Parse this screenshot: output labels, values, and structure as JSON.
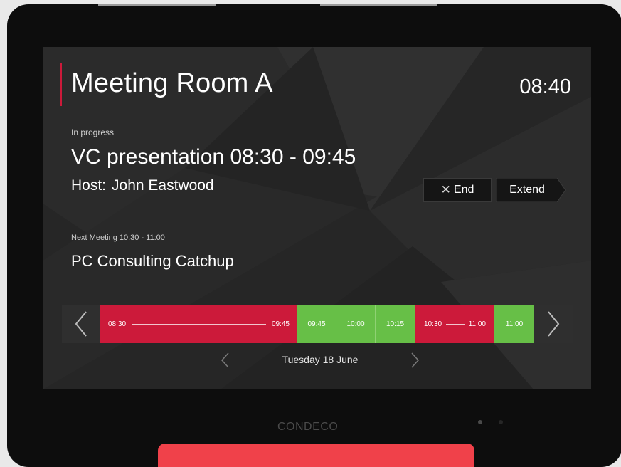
{
  "room": {
    "name": "Meeting Room A",
    "time": "08:40"
  },
  "current_meeting": {
    "status": "In progress",
    "title": "VC presentation 08:30 - 09:45",
    "host_label": "Host:",
    "host_name": "John Eastwood"
  },
  "actions": {
    "end_label": "End",
    "extend_label": "Extend"
  },
  "next_meeting": {
    "label": "Next Meeting 10:30 - 11:00",
    "title": "PC Consulting Catchup"
  },
  "timeline": {
    "slots": [
      {
        "status": "booked",
        "start": "08:30",
        "end": "09:45"
      },
      {
        "status": "free",
        "label": "09:45"
      },
      {
        "status": "free",
        "label": "10:00"
      },
      {
        "status": "free",
        "label": "10:15"
      },
      {
        "status": "booked",
        "start": "10:30",
        "end": "11:00"
      },
      {
        "status": "free",
        "label": "11:00"
      }
    ]
  },
  "date": "Tuesday 18 June",
  "device": {
    "brand": "CONDECO"
  },
  "colors": {
    "accent_red": "#cc1a3a",
    "free_green": "#67bf47",
    "screen_bg": "#262626",
    "bottom_bar": "#f0414a"
  },
  "icons": {
    "prev_timeline": "chevron-left-icon",
    "next_timeline": "chevron-right-icon",
    "prev_date": "chevron-left-icon",
    "next_date": "chevron-right-icon",
    "end": "close-icon"
  }
}
